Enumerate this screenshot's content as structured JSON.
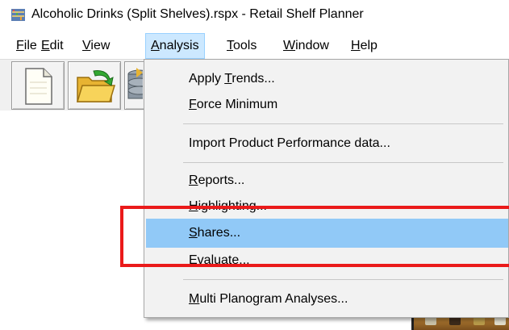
{
  "window": {
    "title": "Alcoholic Drinks (Split Shelves).rspx - Retail Shelf Planner",
    "app_icon": "shelf-planner-icon"
  },
  "menubar": {
    "items": [
      {
        "pre": "",
        "mn": "F",
        "post": "ile"
      },
      {
        "pre": "",
        "mn": "E",
        "post": "dit"
      },
      {
        "pre": "",
        "mn": "V",
        "post": "iew"
      },
      {
        "pre": "",
        "mn": "A",
        "post": "nalysis"
      },
      {
        "pre": "",
        "mn": "T",
        "post": "ools"
      },
      {
        "pre": "",
        "mn": "W",
        "post": "indow"
      },
      {
        "pre": "",
        "mn": "H",
        "post": "elp"
      }
    ],
    "active_index": 3
  },
  "toolbar": {
    "buttons": [
      {
        "icon": "new-document-icon"
      },
      {
        "icon": "open-folder-icon"
      },
      {
        "icon": "database-icon"
      }
    ]
  },
  "analysis_menu": {
    "items": [
      {
        "pre": "Apply ",
        "mn": "T",
        "post": "rends..."
      },
      {
        "pre": "",
        "mn": "F",
        "post": "orce Minimum"
      },
      {
        "pre": "Import Product Performance data...",
        "mn": "",
        "post": ""
      },
      {
        "pre": "",
        "mn": "R",
        "post": "eports..."
      },
      {
        "pre": "",
        "mn": "H",
        "post": "ighlighting..."
      },
      {
        "pre": "",
        "mn": "S",
        "post": "hares..."
      },
      {
        "pre": "",
        "mn": "E",
        "post": "valuate..."
      },
      {
        "pre": "",
        "mn": "M",
        "post": "ulti Planogram Analyses..."
      }
    ],
    "selected_index": 5
  },
  "annotation": {
    "color": "#ea1a1a"
  }
}
